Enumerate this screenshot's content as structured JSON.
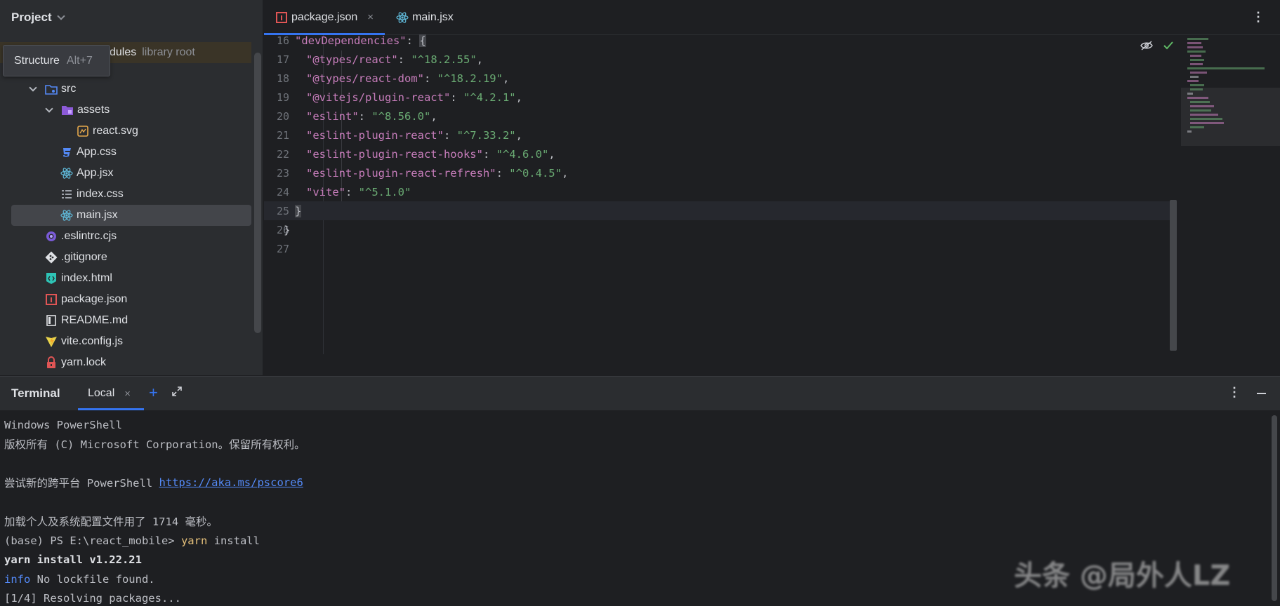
{
  "project": {
    "title": "Project",
    "tooltip": {
      "label": "Structure",
      "shortcut": "Alt+7"
    },
    "node_modules": {
      "label": "node_modules",
      "visible_part": "dules",
      "muted": "library root"
    },
    "tree": [
      {
        "name": "src",
        "kind": "folder"
      },
      {
        "name": "assets",
        "kind": "assets-folder"
      },
      {
        "name": "react.svg",
        "kind": "svg"
      },
      {
        "name": "App.css",
        "kind": "css"
      },
      {
        "name": "App.jsx",
        "kind": "react"
      },
      {
        "name": "index.css",
        "kind": "css-lines"
      },
      {
        "name": "main.jsx",
        "kind": "react"
      },
      {
        "name": ".eslintrc.cjs",
        "kind": "eslint"
      },
      {
        "name": ".gitignore",
        "kind": "git"
      },
      {
        "name": "index.html",
        "kind": "html"
      },
      {
        "name": "package.json",
        "kind": "npm"
      },
      {
        "name": "README.md",
        "kind": "readme"
      },
      {
        "name": "vite.config.js",
        "kind": "vite"
      },
      {
        "name": "yarn.lock",
        "kind": "lock"
      }
    ]
  },
  "editor": {
    "tabs": [
      {
        "label": "package.json",
        "close": "×"
      },
      {
        "label": "main.jsx"
      }
    ],
    "more": "⋮",
    "lines": [
      {
        "n": "16",
        "key": "\"devDependencies\"",
        "tail": ": ",
        "brace": "{"
      },
      {
        "n": "17",
        "key": "\"@types/react\"",
        "val": "\"^18.2.55\""
      },
      {
        "n": "18",
        "key": "\"@types/react-dom\"",
        "val": "\"^18.2.19\""
      },
      {
        "n": "19",
        "key": "\"@vitejs/plugin-react\"",
        "val": "\"^4.2.1\""
      },
      {
        "n": "20",
        "key": "\"eslint\"",
        "val": "\"^8.56.0\""
      },
      {
        "n": "21",
        "key": "\"eslint-plugin-react\"",
        "val": "\"^7.33.2\""
      },
      {
        "n": "22",
        "key": "\"eslint-plugin-react-hooks\"",
        "val": "\"^4.6.0\""
      },
      {
        "n": "23",
        "key": "\"eslint-plugin-react-refresh\"",
        "val": "\"^0.4.5\""
      },
      {
        "n": "24",
        "key": "\"vite\"",
        "val": "\"^5.1.0\""
      },
      {
        "n": "25",
        "text": "}"
      },
      {
        "n": "26",
        "text": "}"
      },
      {
        "n": "27",
        "text": ""
      }
    ],
    "current_line": "25"
  },
  "terminal": {
    "title": "Terminal",
    "tab": {
      "label": "Local",
      "close": "×"
    },
    "add": "+",
    "more": "⋮",
    "lines": {
      "l1": "Windows PowerShell",
      "l2": "版权所有 (C) Microsoft Corporation。保留所有权利。",
      "l3": "",
      "l4_prefix": "尝试新的跨平台 PowerShell ",
      "l4_link": "https://aka.ms/pscore6",
      "l5": "",
      "l6": "加载个人及系统配置文件用了 1714 毫秒。",
      "l7_prompt": "(base) PS E:\\react_mobile> ",
      "l7_cmd": "yarn",
      "l7_arg": " install",
      "l8": "yarn install v1.22.21",
      "l9_info": "info",
      "l9_rest": " No lockfile found.",
      "l10": "[1/4] Resolving packages..."
    }
  },
  "watermark": "头条 @局外人LZ",
  "colors": {
    "accent": "#3574f0",
    "string": "#6aab73",
    "key": "#c77dbb",
    "panel": "#2b2d30",
    "editor_bg": "#1e1f22"
  }
}
